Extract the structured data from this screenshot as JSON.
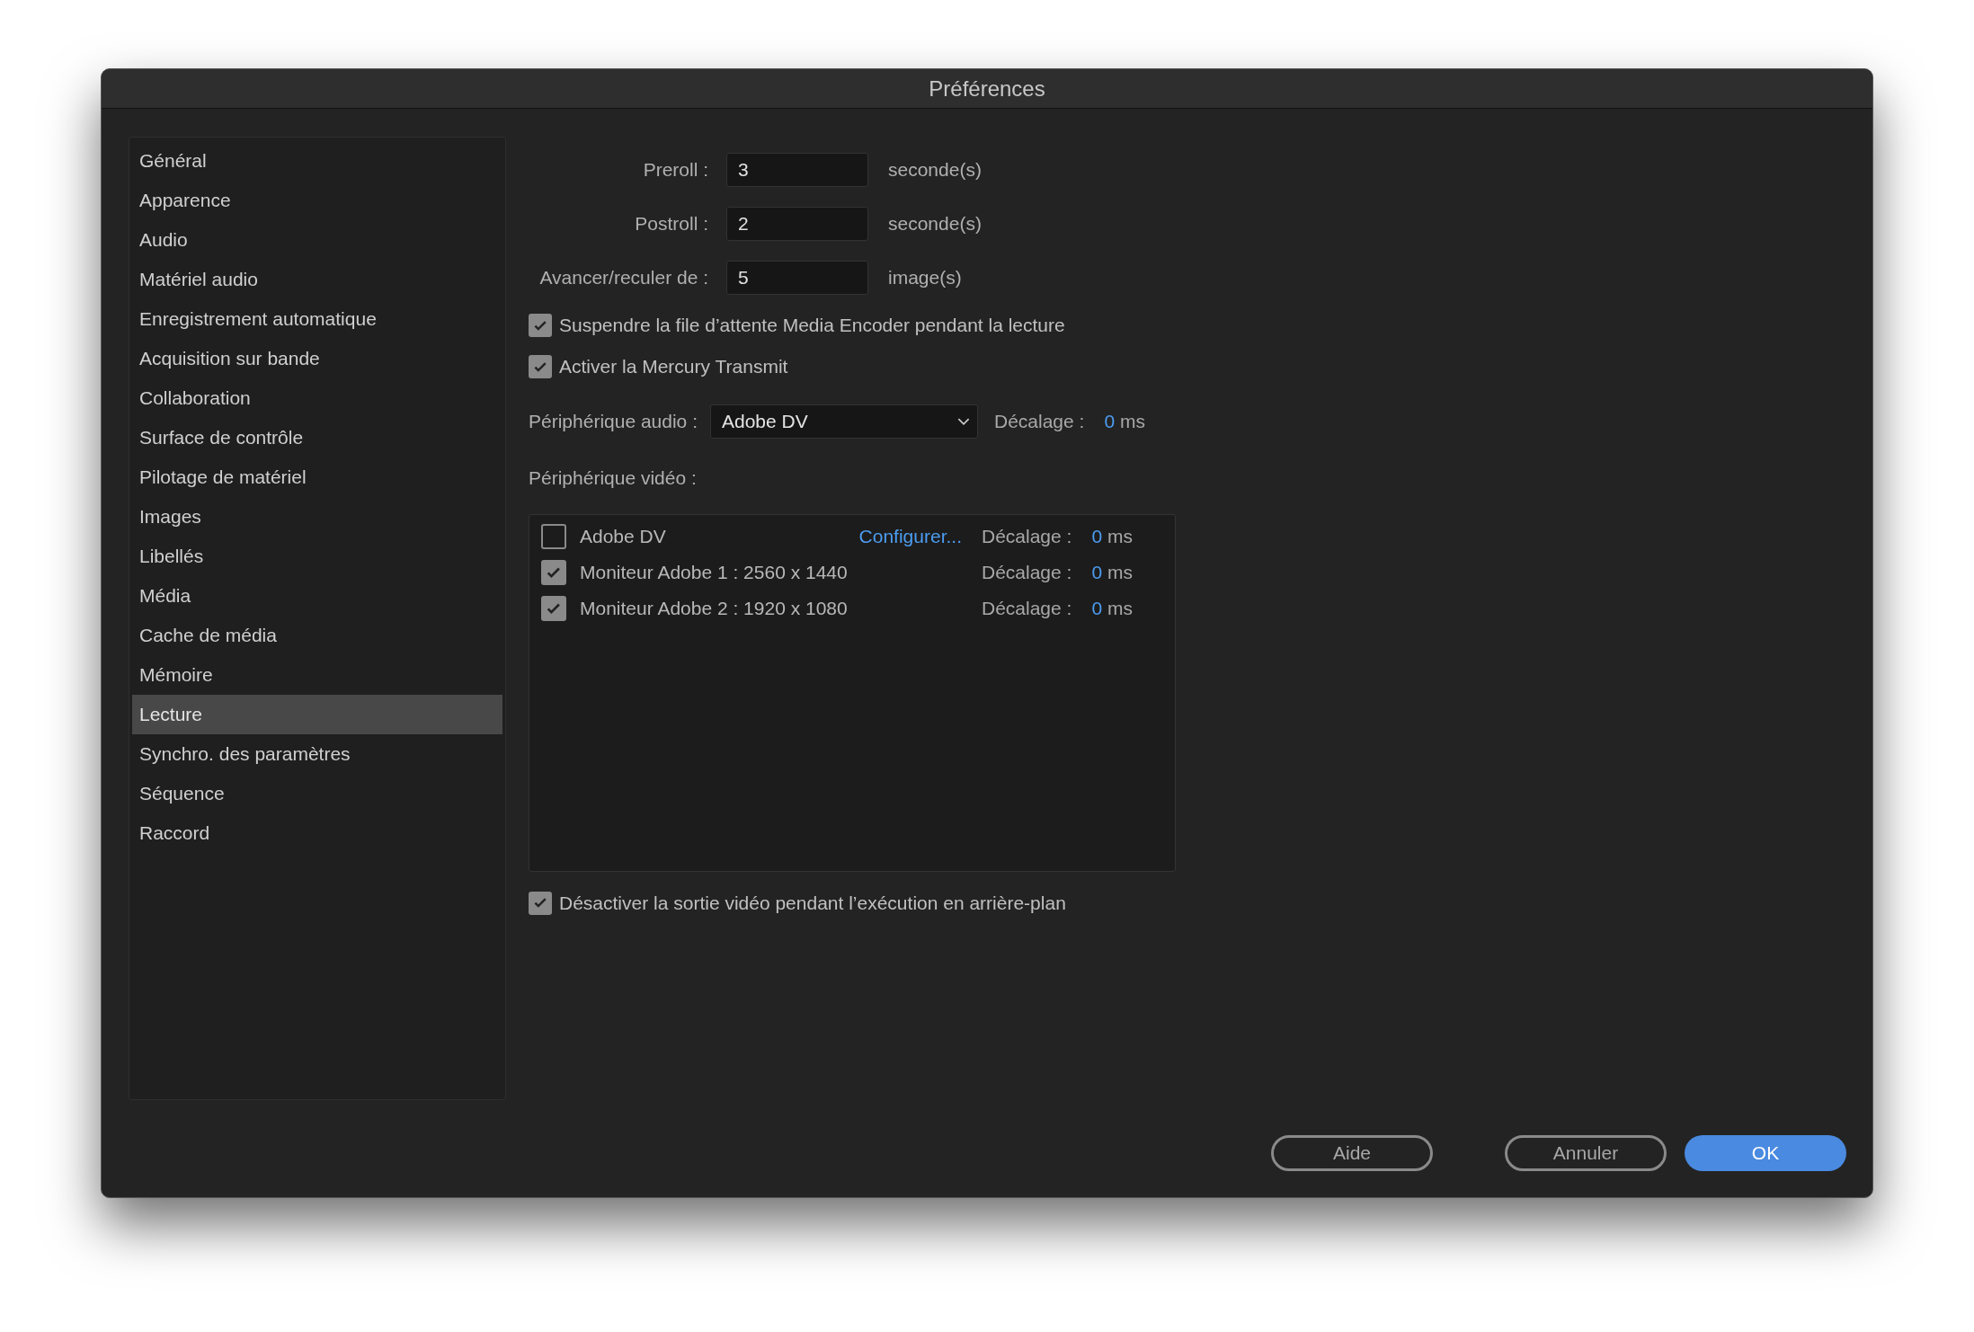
{
  "window": {
    "title": "Préférences"
  },
  "sidebar": {
    "items": [
      {
        "label": "Général",
        "selected": false
      },
      {
        "label": "Apparence",
        "selected": false
      },
      {
        "label": "Audio",
        "selected": false
      },
      {
        "label": "Matériel audio",
        "selected": false
      },
      {
        "label": "Enregistrement automatique",
        "selected": false
      },
      {
        "label": "Acquisition sur bande",
        "selected": false
      },
      {
        "label": "Collaboration",
        "selected": false
      },
      {
        "label": "Surface de contrôle",
        "selected": false
      },
      {
        "label": "Pilotage de matériel",
        "selected": false
      },
      {
        "label": "Images",
        "selected": false
      },
      {
        "label": "Libellés",
        "selected": false
      },
      {
        "label": "Média",
        "selected": false
      },
      {
        "label": "Cache de média",
        "selected": false
      },
      {
        "label": "Mémoire",
        "selected": false
      },
      {
        "label": "Lecture",
        "selected": true
      },
      {
        "label": "Synchro. des paramètres",
        "selected": false
      },
      {
        "label": "Séquence",
        "selected": false
      },
      {
        "label": "Raccord",
        "selected": false
      }
    ]
  },
  "fields": [
    {
      "label": "Preroll :",
      "value": "3",
      "unit": "seconde(s)"
    },
    {
      "label": "Postroll :",
      "value": "2",
      "unit": "seconde(s)"
    },
    {
      "label": "Avancer/reculer de :",
      "value": "5",
      "unit": "image(s)"
    }
  ],
  "options": [
    {
      "label": "Suspendre la file d’attente Media Encoder pendant la lecture",
      "checked": true
    },
    {
      "label": "Activer la Mercury Transmit",
      "checked": true
    }
  ],
  "audio_device": {
    "label": "Périphérique audio :",
    "value": "Adobe DV",
    "offset_label": "Décalage :",
    "offset_value": "0",
    "offset_unit": "ms"
  },
  "video_device": {
    "label": "Périphérique vidéo :",
    "devices": [
      {
        "name": "Adobe DV",
        "checked": false,
        "link": "Configurer...",
        "offset_label": "Décalage :",
        "offset_value": "0",
        "offset_unit": "ms"
      },
      {
        "name": "Moniteur Adobe 1 : 2560 x 1440",
        "checked": true,
        "offset_label": "Décalage :",
        "offset_value": "0",
        "offset_unit": "ms"
      },
      {
        "name": "Moniteur Adobe 2 : 1920 x 1080",
        "checked": true,
        "offset_label": "Décalage :",
        "offset_value": "0",
        "offset_unit": "ms"
      }
    ]
  },
  "background_option": {
    "label": "Désactiver la sortie vidéo pendant l’exécution en arrière-plan",
    "checked": true
  },
  "buttons": [
    {
      "label": "Aide",
      "kind": "secondary"
    },
    {
      "label": "Annuler",
      "kind": "secondary"
    },
    {
      "label": "OK",
      "kind": "primary"
    }
  ]
}
